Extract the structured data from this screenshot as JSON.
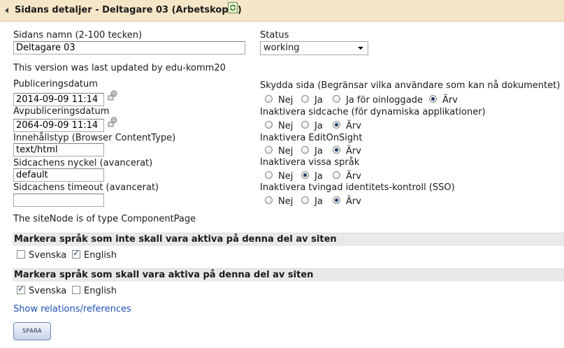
{
  "header": {
    "title": "Sidans detaljer - Deltagare 03 (Arbetskopia)",
    "collapse_icon": "triangle-left-icon",
    "refresh_icon": "refresh-icon"
  },
  "form": {
    "page_name_label": "Sidans namn (2-100 tecken)",
    "page_name_value": "Deltagare 03",
    "status_label": "Status",
    "status_value": "working",
    "last_updated": "This version was last updated by edu-komm20",
    "publish_date_label": "Publiceringsdatum",
    "publish_date_value": "2014-09-09 11:14",
    "unpublish_date_label": "Avpubliceringsdatum",
    "unpublish_date_value": "2064-09-09 11:14",
    "content_type_label": "Innehållstyp (Browser ContentType)",
    "content_type_value": "text/html",
    "cache_key_label": "Sidcachens nyckel (avancerat)",
    "cache_key_value": "default",
    "cache_timeout_label": "Sidcachens timeout (avancerat)",
    "cache_timeout_value": "",
    "site_node_type": "The siteNode is of type ComponentPage"
  },
  "options": {
    "protect": {
      "label": "Skydda sida (Begränsar vilka användare som kan nå dokumentet)",
      "opt_no": "Nej",
      "opt_yes": "Ja",
      "opt_extra": "Ja för oinloggade",
      "opt_inherit": "Ärv",
      "selected": "Ärv"
    },
    "disable_cache": {
      "label": "Inaktivera sidcache (för dynamiska applikationer)",
      "opt_no": "Nej",
      "opt_yes": "Ja",
      "opt_inherit": "Ärv",
      "selected": "Ärv"
    },
    "disable_editonsight": {
      "label": "Inaktivera EditOnSight",
      "opt_no": "Nej",
      "opt_yes": "Ja",
      "opt_inherit": "Ärv",
      "selected": "Ärv"
    },
    "disable_languages": {
      "label": "Inaktivera vissa språk",
      "opt_no": "Nej",
      "opt_yes": "Ja",
      "opt_inherit": "Ärv",
      "selected": "Ja"
    },
    "disable_sso": {
      "label": "Inaktivera tvingad identitets-kontroll (SSO)",
      "opt_no": "Nej",
      "opt_yes": "Ja",
      "opt_inherit": "Ärv",
      "selected": "Ärv"
    }
  },
  "inactive_languages": {
    "title": "Markera språk som inte skall vara aktiva på denna del av siten",
    "swedish": "Svenska",
    "swedish_checked": false,
    "english": "English",
    "english_checked": true
  },
  "active_languages": {
    "title": "Markera språk som skall vara aktiva på denna del av siten",
    "swedish": "Svenska",
    "swedish_checked": true,
    "english": "English",
    "english_checked": false
  },
  "relations_link": "Show relations/references",
  "save_button": "SPARA"
}
